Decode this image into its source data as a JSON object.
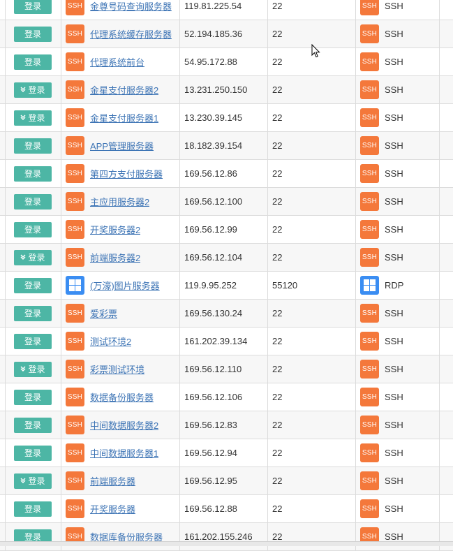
{
  "login_label": "登录",
  "colors": {
    "button": "#4db6a5",
    "ssh_badge": "#f4783b",
    "windows_badge": "#3a8df2",
    "link": "#3d74b5"
  },
  "rows": [
    {
      "name": "金尊号码查询服务器",
      "ip": "119.81.225.54",
      "port": "22",
      "protocol": "SSH",
      "icon": "ssh-icon",
      "dropdown": false
    },
    {
      "name": "代理系统缓存服务器",
      "ip": "52.194.185.36",
      "port": "22",
      "protocol": "SSH",
      "icon": "ssh-icon",
      "dropdown": false
    },
    {
      "name": "代理系统前台",
      "ip": "54.95.172.88",
      "port": "22",
      "protocol": "SSH",
      "icon": "ssh-icon",
      "dropdown": false
    },
    {
      "name": "金星支付服务器2",
      "ip": "13.231.250.150",
      "port": "22",
      "protocol": "SSH",
      "icon": "ssh-icon",
      "dropdown": true
    },
    {
      "name": "金星支付服务器1",
      "ip": "13.230.39.145",
      "port": "22",
      "protocol": "SSH",
      "icon": "ssh-icon",
      "dropdown": true
    },
    {
      "name": "APP管理服务器",
      "ip": "18.182.39.154",
      "port": "22",
      "protocol": "SSH",
      "icon": "ssh-icon",
      "dropdown": false
    },
    {
      "name": "第四方支付服务器",
      "ip": "169.56.12.86",
      "port": "22",
      "protocol": "SSH",
      "icon": "ssh-icon",
      "dropdown": false
    },
    {
      "name": "主应用服务器2",
      "ip": "169.56.12.100",
      "port": "22",
      "protocol": "SSH",
      "icon": "ssh-icon",
      "dropdown": false
    },
    {
      "name": "开奖服务器2",
      "ip": "169.56.12.99",
      "port": "22",
      "protocol": "SSH",
      "icon": "ssh-icon",
      "dropdown": false
    },
    {
      "name": "前端服务器2",
      "ip": "169.56.12.104",
      "port": "22",
      "protocol": "SSH",
      "icon": "ssh-icon",
      "dropdown": true
    },
    {
      "name": "(万濠)图片服务器",
      "ip": "119.9.95.252",
      "port": "55120",
      "protocol": "RDP",
      "icon": "windows-icon",
      "dropdown": false
    },
    {
      "name": "爱彩票",
      "ip": "169.56.130.24",
      "port": "22",
      "protocol": "SSH",
      "icon": "ssh-icon",
      "dropdown": false
    },
    {
      "name": "测试环境2",
      "ip": "161.202.39.134",
      "port": "22",
      "protocol": "SSH",
      "icon": "ssh-icon",
      "dropdown": false
    },
    {
      "name": "彩票测试环境",
      "ip": "169.56.12.110",
      "port": "22",
      "protocol": "SSH",
      "icon": "ssh-icon",
      "dropdown": true
    },
    {
      "name": "数据备份服务器",
      "ip": "169.56.12.106",
      "port": "22",
      "protocol": "SSH",
      "icon": "ssh-icon",
      "dropdown": false
    },
    {
      "name": "中间数据服务器2",
      "ip": "169.56.12.83",
      "port": "22",
      "protocol": "SSH",
      "icon": "ssh-icon",
      "dropdown": false
    },
    {
      "name": "中间数据服务器1",
      "ip": "169.56.12.94",
      "port": "22",
      "protocol": "SSH",
      "icon": "ssh-icon",
      "dropdown": false
    },
    {
      "name": "前端服务器",
      "ip": "169.56.12.95",
      "port": "22",
      "protocol": "SSH",
      "icon": "ssh-icon",
      "dropdown": true
    },
    {
      "name": "开奖服务器",
      "ip": "169.56.12.88",
      "port": "22",
      "protocol": "SSH",
      "icon": "ssh-icon",
      "dropdown": false
    },
    {
      "name": "数据库备份服务器",
      "ip": "161.202.155.246",
      "port": "22",
      "protocol": "SSH",
      "icon": "ssh-icon",
      "dropdown": false
    }
  ]
}
